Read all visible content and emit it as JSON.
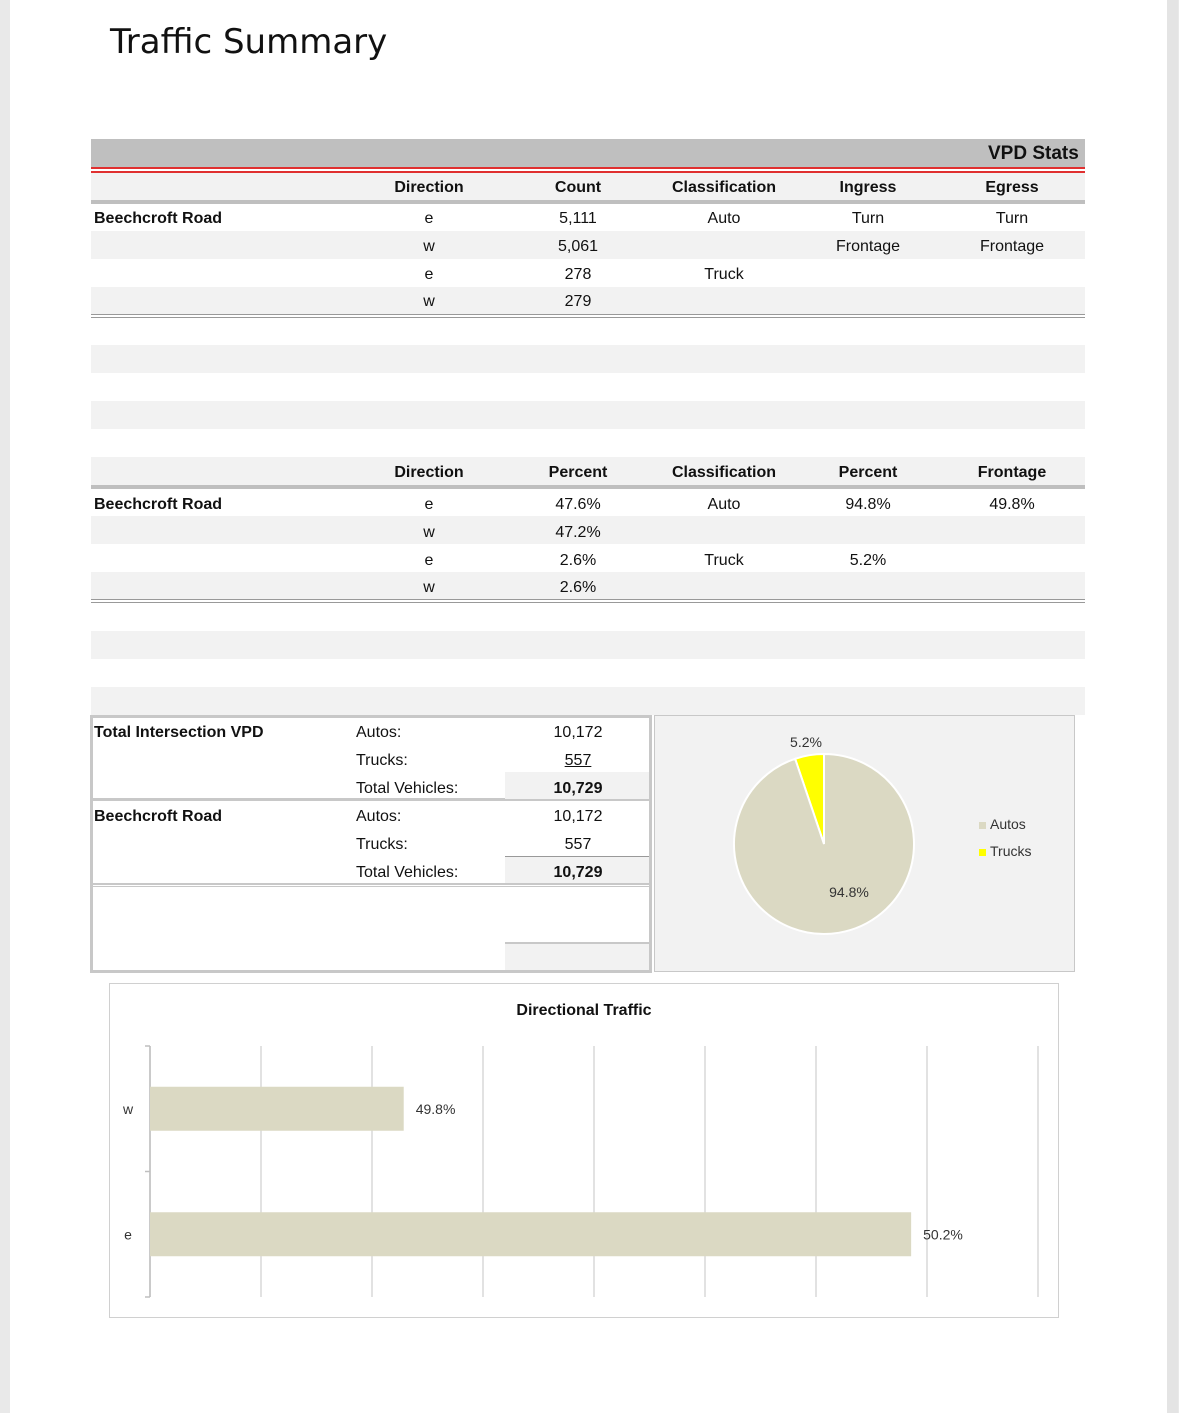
{
  "title": "Traffic Summary",
  "vpd_header": "VPD Stats",
  "counts_table": {
    "headers": [
      "Direction",
      "Count",
      "Classification",
      "Ingress",
      "Egress"
    ],
    "road": "Beechcroft Road",
    "rows": [
      {
        "direction": "e",
        "count": "5,111",
        "classification": "Auto",
        "ingress": "Turn",
        "egress": "Turn"
      },
      {
        "direction": "w",
        "count": "5,061",
        "classification": "",
        "ingress": "Frontage",
        "egress": "Frontage"
      },
      {
        "direction": "e",
        "count": "278",
        "classification": "Truck",
        "ingress": "",
        "egress": ""
      },
      {
        "direction": "w",
        "count": "279",
        "classification": "",
        "ingress": "",
        "egress": ""
      }
    ]
  },
  "percent_table": {
    "headers": [
      "Direction",
      "Percent",
      "Classification",
      "Percent",
      "Frontage"
    ],
    "road": "Beechcroft Road",
    "rows": [
      {
        "direction": "e",
        "percent": "47.6%",
        "classification": "Auto",
        "class_percent": "94.8%",
        "frontage": "49.8%"
      },
      {
        "direction": "w",
        "percent": "47.2%",
        "classification": "",
        "class_percent": "",
        "frontage": ""
      },
      {
        "direction": "e",
        "percent": "2.6%",
        "classification": "Truck",
        "class_percent": "5.2%",
        "frontage": ""
      },
      {
        "direction": "w",
        "percent": "2.6%",
        "classification": "",
        "class_percent": "",
        "frontage": ""
      }
    ]
  },
  "totals": {
    "intersection": {
      "label": "Total Intersection VPD",
      "autos_label": "Autos:",
      "autos": "10,172",
      "trucks_label": "Trucks:",
      "trucks": "557",
      "total_label": "Total Vehicles:",
      "total": "10,729"
    },
    "road": {
      "label": "Beechcroft Road",
      "autos_label": "Autos:",
      "autos": "10,172",
      "trucks_label": "Trucks:",
      "trucks": "557",
      "total_label": "Total Vehicles:",
      "total": "10,729"
    }
  },
  "chart_data": [
    {
      "type": "pie",
      "title": "",
      "categories": [
        "Autos",
        "Trucks"
      ],
      "values": [
        94.8,
        5.2
      ],
      "labels": [
        "94.8%",
        "5.2%"
      ],
      "colors": [
        "#dbd9c3",
        "#ffff00"
      ],
      "legend": "right"
    },
    {
      "type": "bar",
      "orientation": "horizontal",
      "title": "Directional Traffic",
      "categories": [
        "w",
        "e"
      ],
      "values": [
        49.8,
        50.2
      ],
      "labels": [
        "49.8%",
        "50.2%"
      ],
      "colors": [
        "#dbd9c3"
      ],
      "grid": true
    }
  ]
}
